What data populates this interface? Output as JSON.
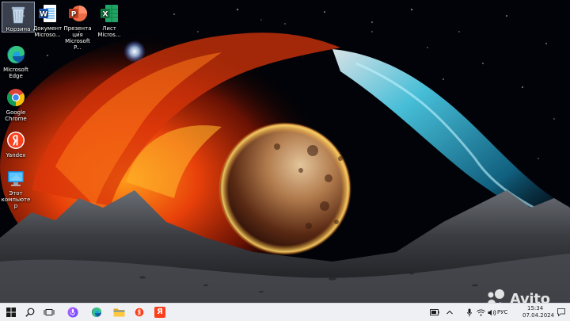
{
  "desktop": {
    "icons": [
      {
        "label": "Корзина",
        "icon": "recycle-bin-icon"
      },
      {
        "label": "Документ Microso...",
        "icon": "word-document-icon"
      },
      {
        "label": "Презентация Microsoft P...",
        "icon": "powerpoint-icon"
      },
      {
        "label": "Лист Micros...",
        "icon": "excel-sheet-icon"
      },
      {
        "label": "Microsoft Edge",
        "icon": "edge-icon"
      },
      {
        "label": "Google Chrome",
        "icon": "chrome-icon"
      },
      {
        "label": "Yandex",
        "icon": "yandex-browser-icon"
      },
      {
        "label": "Этот компьютер",
        "icon": "this-pc-icon"
      }
    ]
  },
  "taskbar": {
    "items": [
      "start-icon",
      "search-icon",
      "task-view-icon",
      "alice-icon",
      "edge-icon",
      "file-explorer-icon",
      "yandex-browser-icon",
      "yandex-icon"
    ],
    "yandex_letter": "Я",
    "tray": {
      "language": "РУС",
      "time": "15:34",
      "date": "07.04.2024"
    }
  },
  "watermark": {
    "text": "Avito"
  },
  "colors": {
    "taskbar_bg": "#eef0f4",
    "space_bg": "#020308",
    "fire": "#ff5a0a",
    "nebula_blue": "#3ec8e6"
  }
}
